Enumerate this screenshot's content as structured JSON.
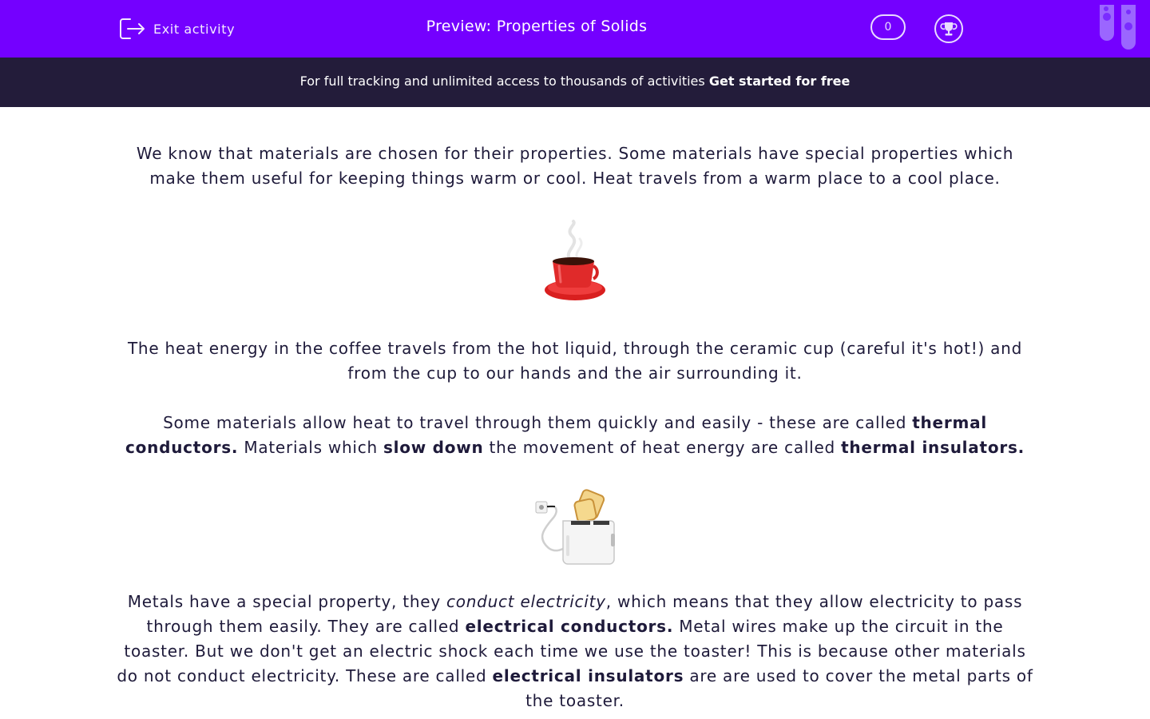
{
  "header": {
    "exit_label": "Exit activity",
    "title": "Preview: Properties of Solids",
    "score": "0",
    "exit_icon": "exit-icon",
    "trophy_icon": "trophy-icon",
    "colors": {
      "bar": "#7400ff",
      "promo": "#231c3a"
    }
  },
  "promo": {
    "text": "For full tracking and unlimited access to thousands of activities ",
    "cta": "Get started for free"
  },
  "content": {
    "p1": "We know that materials are chosen for their properties. Some materials have special properties which make them useful for keeping things warm or cool. Heat travels from a warm place to a cool place.",
    "p2": "The heat energy in the coffee travels from the hot liquid, through the ceramic cup (careful it's hot!) and from the cup to our hands and the air surrounding it.",
    "p3": {
      "a": "Some materials allow heat to travel through them quickly and easily - these are called ",
      "b": "thermal conductors.",
      "c": " Materials which ",
      "d": "slow down",
      "e": " the movement of heat energy are called ",
      "f": "thermal insulators."
    },
    "p4": {
      "a": "Metals have a special property, they ",
      "b": "conduct electricity",
      "c": ", which means that they allow electricity to pass through them easily. They are called ",
      "d": "electrical conductors.",
      "e": " Metal wires make up the circuit in the toaster. But we don't get an electric shock each time we use the toaster! This is because other materials do not conduct electricity. These are called ",
      "f": "electrical insulators",
      "g": " are are used to cover the metal parts of the toaster."
    },
    "images": {
      "cup": "coffee-cup-image",
      "toaster": "toaster-image"
    }
  }
}
